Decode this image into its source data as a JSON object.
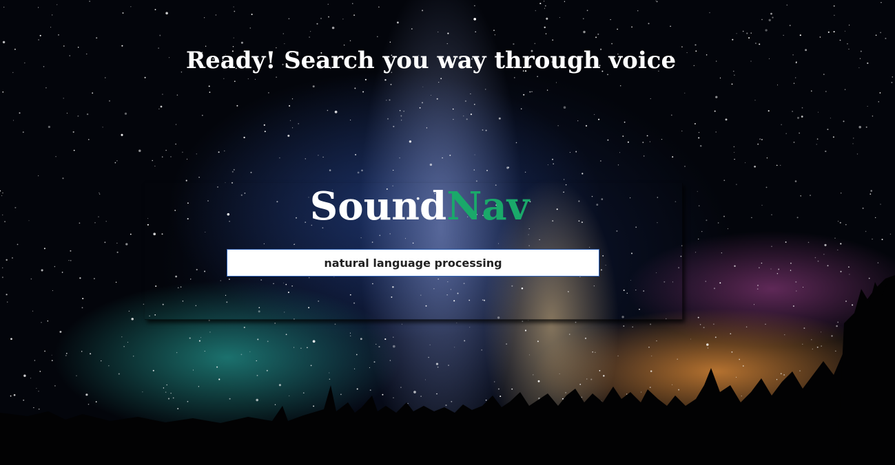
{
  "headline": "Ready! Search you way through voice",
  "logo": {
    "part1": "Sound",
    "part2": "Nav",
    "part2_color": "#1aa96a"
  },
  "search": {
    "value": "natural language processing"
  },
  "background": {
    "description_icon": "starry-night-sky-icon"
  }
}
